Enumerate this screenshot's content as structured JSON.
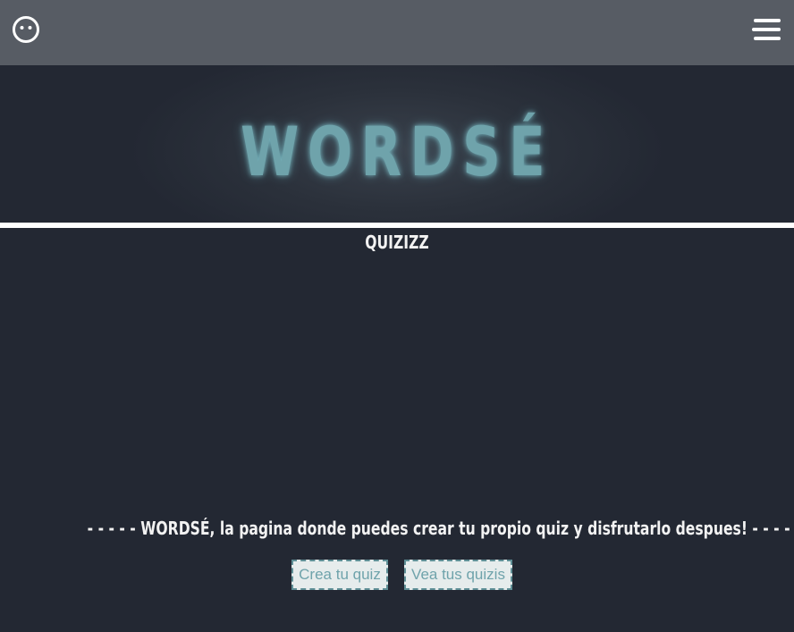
{
  "header": {
    "left_icon": "face-icon",
    "right_icon": "menu-icon"
  },
  "hero": {
    "logo": "WORDSÉ"
  },
  "main": {
    "subtitle": "QUIZIZZ",
    "tagline": "- - - - - WORDSÉ, la pagina donde puedes crear tu propio quiz y disfrutarlo despues! - - - - -",
    "buttons": {
      "create": "Crea tu quiz",
      "view": "Vea tus quizis"
    }
  },
  "colors": {
    "topbar": "#575c64",
    "background": "#232833",
    "accent": "#6fa3ab",
    "button_bg": "#e6ecec"
  }
}
